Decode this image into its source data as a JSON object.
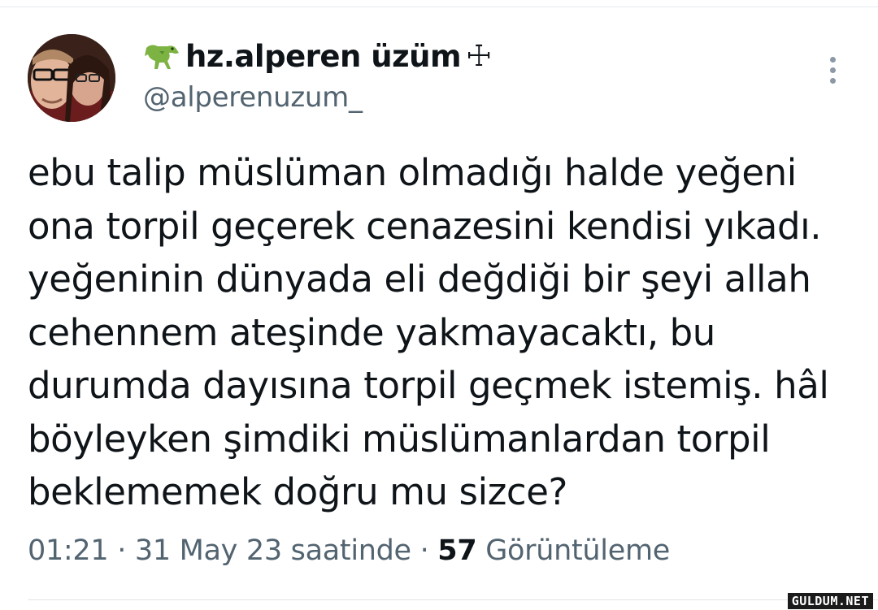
{
  "profile": {
    "display_name": "hz.alperen üzüm",
    "name_suffix_symbol": "☩",
    "name_prefix_icon": "t-rex-icon",
    "handle": "@alperenuzum_"
  },
  "menu": {
    "icon": "more-vertical-icon"
  },
  "tweet": {
    "lines": [
      "ebu talip müslüman olmadığı halde yeğeni",
      "ona torpil geçerek cenazesini kendisi yıkadı.",
      "yeğeninin dünyada eli değdiği bir şeyi allah",
      "cehennem ateşinde yakmayacaktı, bu",
      "durumda dayısına torpil geçmek istemiş. hâl",
      "böyleyken şimdiki müslümanlardan torpil",
      "beklememek doğru mu sizce?"
    ]
  },
  "meta": {
    "time": "01:21",
    "separator": " · ",
    "date": "31 May 23 saatinde",
    "views_count": "57",
    "views_label": "Görüntüleme"
  },
  "watermark": "GULDUM.NET",
  "colors": {
    "text": "#0f1419",
    "secondary": "#536471",
    "divider": "#e6e9ec"
  }
}
